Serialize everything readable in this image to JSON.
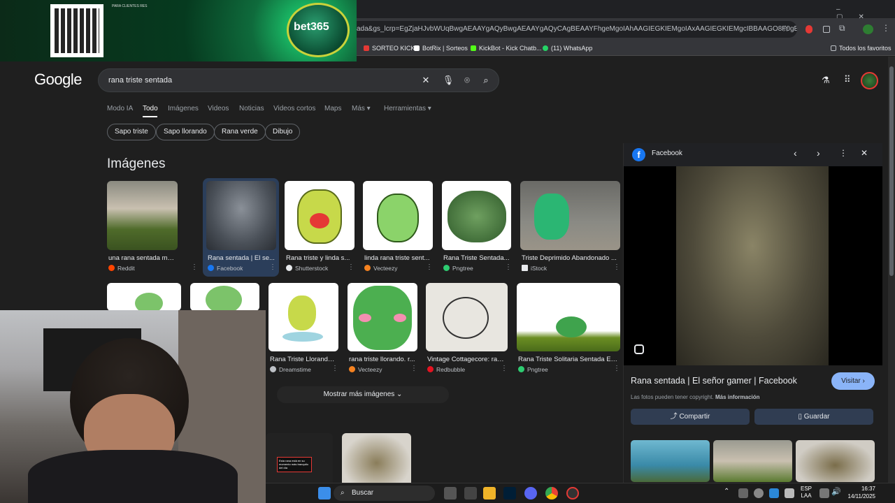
{
  "browser": {
    "url": "ada&gs_lcrp=EgZjaHJvbWUqBwgAEAAYgAQyBwgAEAAYgAQyCAgBEAAYFhgeMgoIAhAAGIEGKIEMgoIAxAAGIEGKIEMgcIBBAAGO8F0gEIMTg...",
    "bookmarks": [
      "SORTEO KICK",
      "BotRix | Sorteos",
      "KickBot - Kick Chatb...",
      "(11) WhatsApp"
    ],
    "all_bookmarks": "Todos los favoritos"
  },
  "ad": {
    "brand": "bet365",
    "small_text": "PARA CLIENTES RES"
  },
  "google": {
    "logo": "Google",
    "query": "rana triste sentada",
    "tabs": [
      "Modo IA",
      "Todo",
      "Imágenes",
      "Videos",
      "Noticias",
      "Videos cortos",
      "Maps",
      "Más",
      "Herramientas"
    ],
    "active_tab": "Todo",
    "chips": [
      "Sapo triste",
      "Sapo llorando",
      "Rana verde",
      "Dibujo"
    ],
    "images_title": "Imágenes",
    "row1": [
      {
        "caption": "una rana sentada muy triste...",
        "source": "Reddit",
        "color": "#ff4500"
      },
      {
        "caption": "Rana sentada | El se...",
        "source": "Facebook",
        "color": "#1877f2"
      },
      {
        "caption": "Rana triste y linda s...",
        "source": "Shutterstock",
        "color": "#e8eaed"
      },
      {
        "caption": "linda rana triste sent...",
        "source": "Vecteezy",
        "color": "#f58220"
      },
      {
        "caption": "Rana Triste Sentada...",
        "source": "Pngtree",
        "color": "#2ecc71"
      },
      {
        "caption": "Triste Deprimido Abandonado ...",
        "source": "iStock",
        "color": "#e8eaed"
      }
    ],
    "row2": [
      {
        "caption": "Rana Triste Llorando...",
        "source": "Dreamstime",
        "color": "#bdc1c6"
      },
      {
        "caption": "rana triste llorando. r...",
        "source": "Vecteezy",
        "color": "#f58220"
      },
      {
        "caption": "Vintage Cottagecore: ran...",
        "source": "Redbubble",
        "color": "#e41321"
      },
      {
        "caption": "Rana Triste Solitaria Sentada En...",
        "source": "Pngtree",
        "color": "#2ecc71"
      }
    ],
    "more_images": "Mostrar más imágenes",
    "panel": {
      "source": "Facebook",
      "title": "Rana sentada | El señor gamer | Facebook",
      "visit": "Visitar",
      "copyright": "Las fotos pueden tener copyright.",
      "more_info": "Más información",
      "share": "Compartir",
      "save": "Guardar"
    },
    "video_overlay_text": "Esta rana está en su momento más tranquilo del día"
  },
  "taskbar": {
    "search": "Buscar",
    "lang": "ESP",
    "lang2": "LAA",
    "time": "16:37",
    "date": "14/11/2025"
  }
}
